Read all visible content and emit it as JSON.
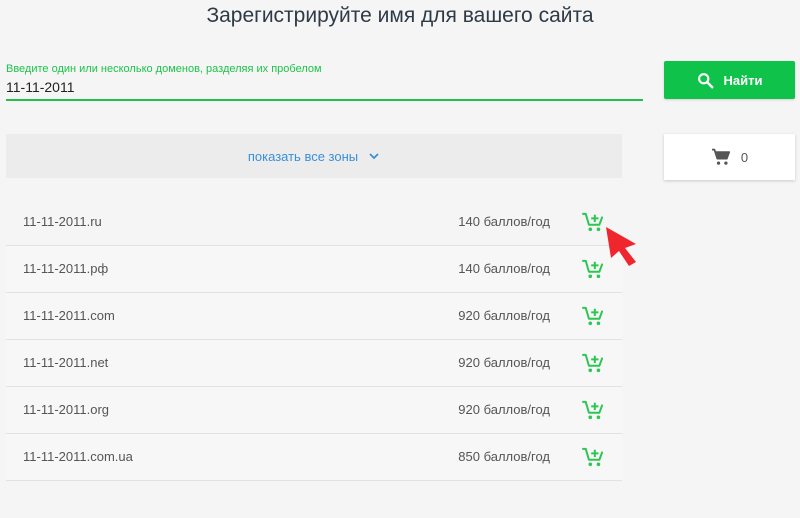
{
  "title": "Зарегистрируйте имя для вашего сайта",
  "search": {
    "label": "Введите один или несколько доменов, разделяя их пробелом",
    "value": "11-11-2011",
    "button_label": "Найти",
    "button_icon": "search-icon"
  },
  "zones": {
    "label": "показать все зоны",
    "icon": "chevron-down-icon"
  },
  "cart": {
    "icon": "cart-icon",
    "count": "0"
  },
  "domains": [
    {
      "name": "11-11-2011.ru",
      "price": "140 баллов/год"
    },
    {
      "name": "11-11-2011.рф",
      "price": "140 баллов/год"
    },
    {
      "name": "11-11-2011.com",
      "price": "920 баллов/год"
    },
    {
      "name": "11-11-2011.net",
      "price": "920 баллов/год"
    },
    {
      "name": "11-11-2011.org",
      "price": "920 баллов/год"
    },
    {
      "name": "11-11-2011.com.ua",
      "price": "850 баллов/год"
    }
  ],
  "colors": {
    "accent": "#0fc24a",
    "link": "#3a8fd8",
    "cursor": "#f0262f"
  }
}
